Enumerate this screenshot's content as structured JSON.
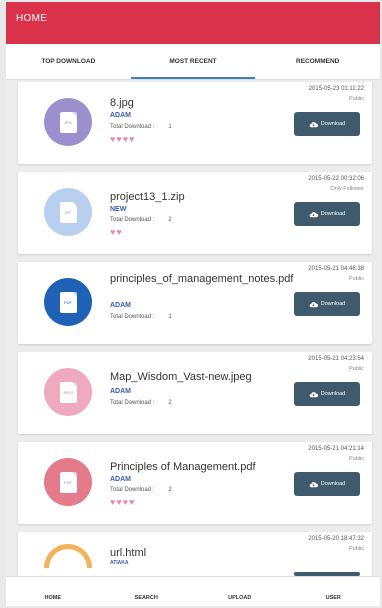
{
  "header": {
    "title": "HOME",
    "color": "#d9324a"
  },
  "tabs": [
    {
      "label": "TOP DOWNLOAD",
      "active": false
    },
    {
      "label": "MOST RECENT",
      "active": true
    },
    {
      "label": "RECOMMEND",
      "active": false
    }
  ],
  "files": [
    {
      "name": "8.jpg",
      "owner": "ADAM",
      "downloads_label": "Total Download :",
      "downloads": "1",
      "hearts": "♥♥♥♥",
      "date": "2015-05-23 01:11:22",
      "privacy": "Public",
      "button": "Download",
      "icon_color": "#9b8fce",
      "ext": "JPG"
    },
    {
      "name": "project13_1.zip",
      "owner": "NEW",
      "downloads_label": "Total Download :",
      "downloads": "2",
      "hearts": "♥♥",
      "date": "2015-05-22 00:32:06",
      "privacy": "Only Follower",
      "button": "Download",
      "icon_color": "#b8cff0",
      "ext": "ZIP"
    },
    {
      "name": "principles_of_management_notes.pdf",
      "owner": "ADAM",
      "downloads_label": "Total Download :",
      "downloads": "1",
      "hearts": "",
      "date": "2015-05-21 04:46:38",
      "privacy": "Public",
      "button": "Download",
      "icon_color": "#1f62b5",
      "ext": "PDF"
    },
    {
      "name": "Map_Wisdom_Vast-new.jpeg",
      "owner": "ADAM",
      "downloads_label": "Total Download :",
      "downloads": "2",
      "hearts": "",
      "date": "2015-05-21 04:23:54",
      "privacy": "Public",
      "button": "Download",
      "icon_color": "#f0aac0",
      "ext": "JPEG"
    },
    {
      "name": "Principles of Management.pdf",
      "owner": "ADAM",
      "downloads_label": "Total Download :",
      "downloads": "2",
      "hearts": "♥♥♥♥",
      "date": "2015-05-21 04:21:14",
      "privacy": "Public",
      "button": "Download",
      "icon_color": "#e57a8a",
      "ext": "PDF"
    },
    {
      "name": "url.html",
      "owner": "ATIAKA",
      "downloads_label": "",
      "downloads": "",
      "hearts": "",
      "date": "2015-05-20 18:47:32",
      "privacy": "Public",
      "button": "",
      "icon_color": "#f2b35a",
      "ext": ""
    }
  ],
  "bottom_nav": [
    {
      "label": "HOME",
      "icon": "home-icon"
    },
    {
      "label": "SEARCH",
      "icon": "search-icon"
    },
    {
      "label": "UPLOAD",
      "icon": "upload-icon"
    },
    {
      "label": "USER",
      "icon": "user-icon"
    }
  ]
}
